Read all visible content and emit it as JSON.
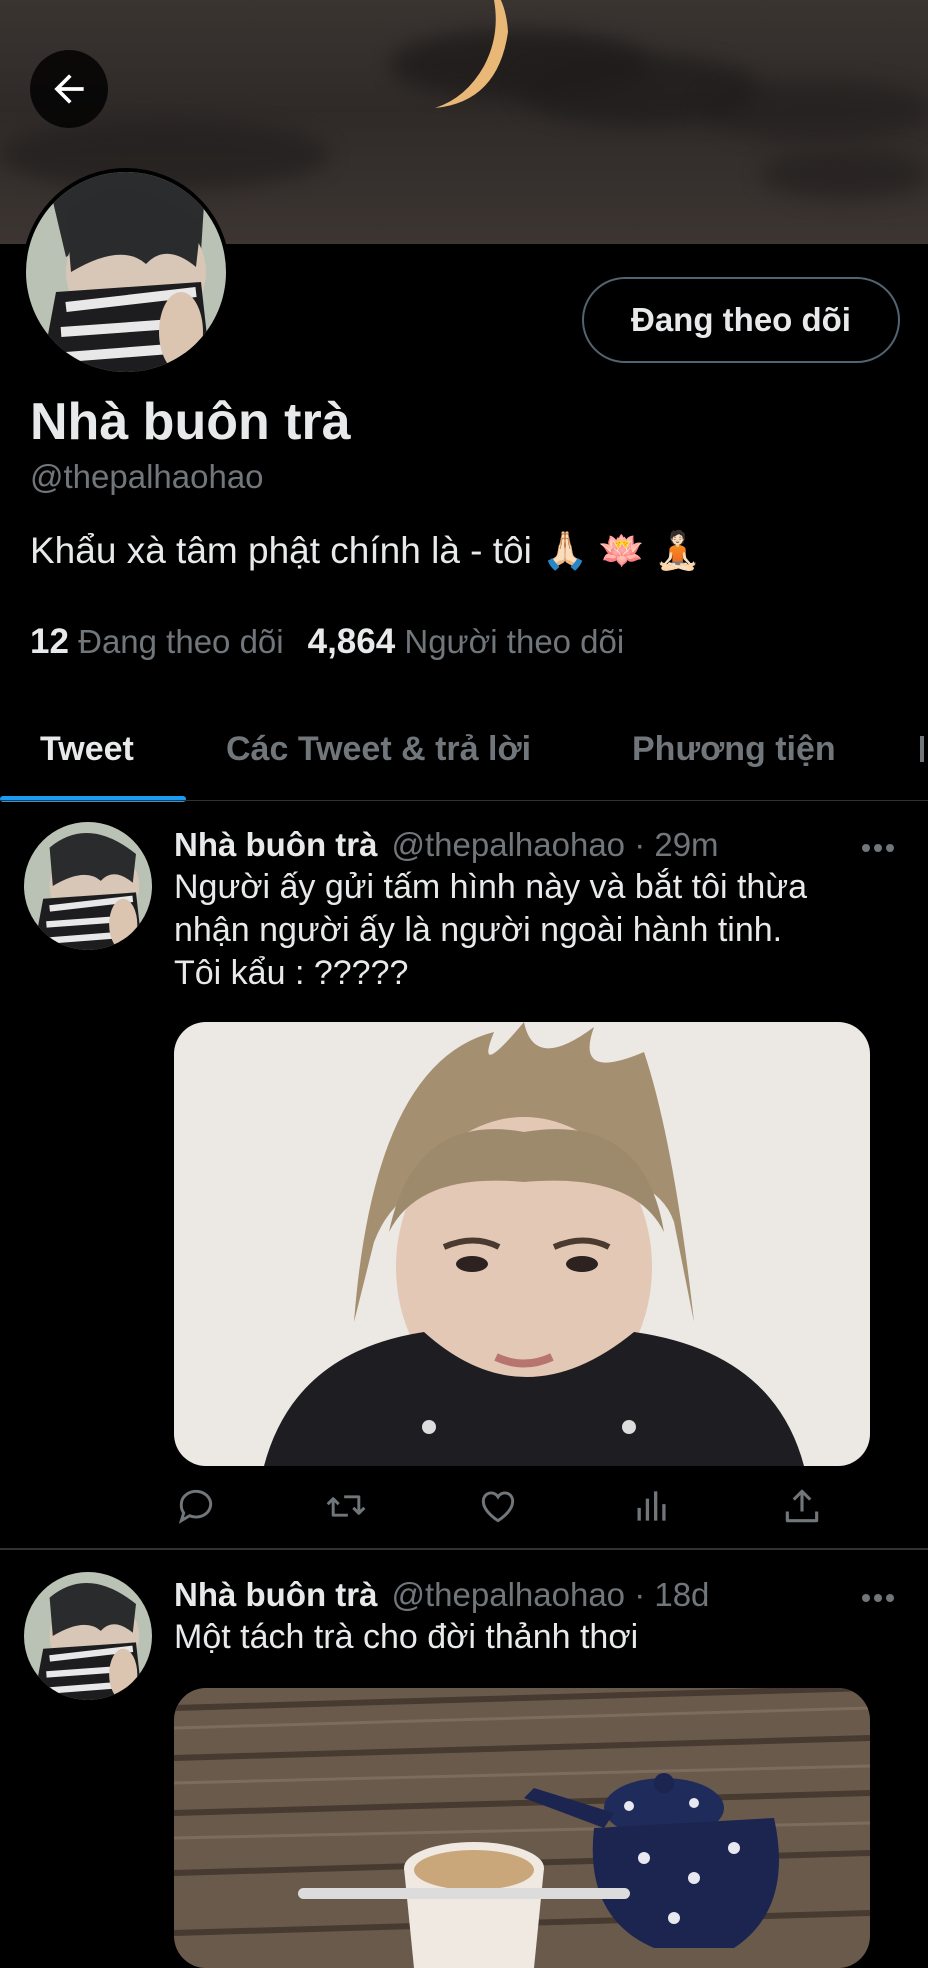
{
  "profile": {
    "display_name": "Nhà buôn trà",
    "handle": "@thepalhaohao",
    "bio": "Khẩu xà tâm phật chính là - tôi 🙏🏻 🪷 🧘🏻",
    "follow_button_label": "Đang theo dõi",
    "following_count": "12",
    "following_label": "Đang theo dõi",
    "followers_count": "4,864",
    "followers_label": "Người theo dõi"
  },
  "tabs": [
    {
      "label": "Tweet",
      "active": true
    },
    {
      "label": "Các Tweet & trả lời",
      "active": false
    },
    {
      "label": "Phương tiện",
      "active": false
    }
  ],
  "tweets": [
    {
      "name": "Nhà buôn trà",
      "meta": "@thepalhaohao · 29m",
      "text": "Người ấy gửi tấm hình này và bắt tôi thừa\nnhận người ấy là người ngoài hành tinh.\nTôi kẩu : ?????"
    },
    {
      "name": "Nhà buôn trà",
      "meta": "@thepalhaohao · 18d",
      "text": "Một tách trà cho đời thảnh thơi"
    }
  ],
  "colors": {
    "accent": "#1d9bf0",
    "background": "#000000",
    "primary_text": "#e7e9ea",
    "secondary_text": "#71767b",
    "border": "#2f3336"
  },
  "icons": [
    "back-arrow-icon",
    "more-icon",
    "reply-icon",
    "retweet-icon",
    "like-icon",
    "analytics-icon",
    "share-icon"
  ]
}
